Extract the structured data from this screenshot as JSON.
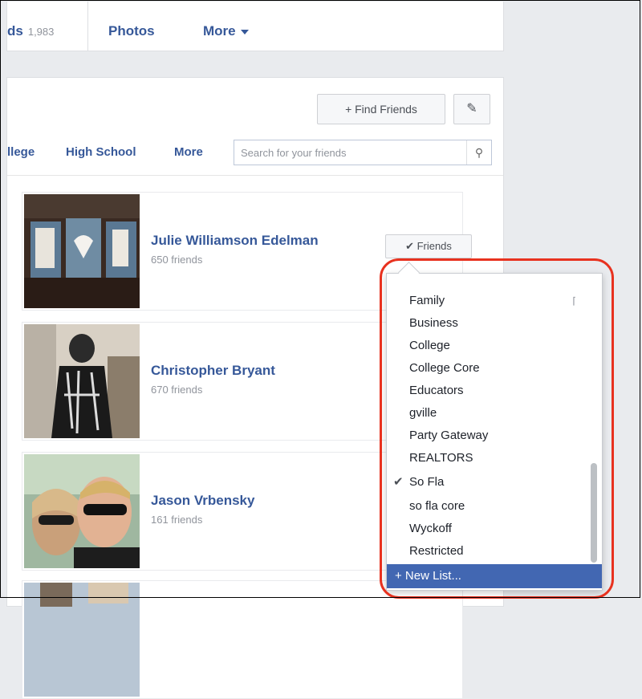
{
  "tabs": {
    "friends_partial": "ds",
    "friends_count": "1,983",
    "photos": "Photos",
    "more": "More"
  },
  "toolbar": {
    "find_friends": "+ Find Friends",
    "edit_icon": "pencil-icon"
  },
  "filters": [
    "llege",
    "High School",
    "More"
  ],
  "search": {
    "placeholder": "Search for your friends"
  },
  "friends": [
    {
      "name": "Julie Williamson Edelman",
      "count": "650 friends",
      "button": "✔ Friends"
    },
    {
      "name": "Christopher Bryant",
      "count": "670 friends"
    },
    {
      "name": "Jason Vrbensky",
      "count": "161 friends"
    }
  ],
  "dropdown": {
    "items": [
      {
        "label": "Family",
        "checked": false,
        "bolt": true
      },
      {
        "label": "Business",
        "checked": false
      },
      {
        "label": "College",
        "checked": false
      },
      {
        "label": "College Core",
        "checked": false
      },
      {
        "label": "Educators",
        "checked": false
      },
      {
        "label": "gville",
        "checked": false
      },
      {
        "label": "Party Gateway",
        "checked": false
      },
      {
        "label": "REALTORS",
        "checked": false
      },
      {
        "label": "So Fla",
        "checked": true
      },
      {
        "label": "so fla core",
        "checked": false
      },
      {
        "label": "Wyckoff",
        "checked": false
      },
      {
        "label": "Restricted",
        "checked": false
      }
    ],
    "new_list": "+ New List..."
  },
  "colors": {
    "link": "#365899",
    "highlight": "#e8321f",
    "selected": "#4267b2"
  }
}
